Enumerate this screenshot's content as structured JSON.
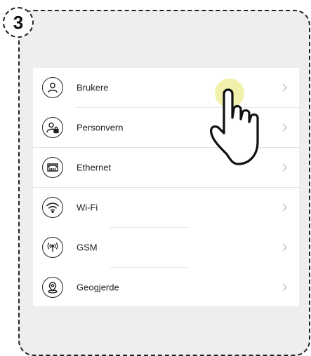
{
  "step": {
    "number": "3"
  },
  "menu": {
    "items": [
      {
        "label": "Brukere",
        "icon": "user-icon"
      },
      {
        "label": "Personvern",
        "icon": "user-lock-icon"
      },
      {
        "label": "Ethernet",
        "icon": "ethernet-icon"
      },
      {
        "label": "Wi-Fi",
        "icon": "wifi-icon"
      },
      {
        "label": "GSM",
        "icon": "antenna-icon"
      },
      {
        "label": "Geogjerde",
        "icon": "location-pin-icon"
      }
    ]
  },
  "colors": {
    "panel": "#eeeeee",
    "tap_highlight": "#f1f0a8",
    "chevron": "#bdbdbd"
  }
}
